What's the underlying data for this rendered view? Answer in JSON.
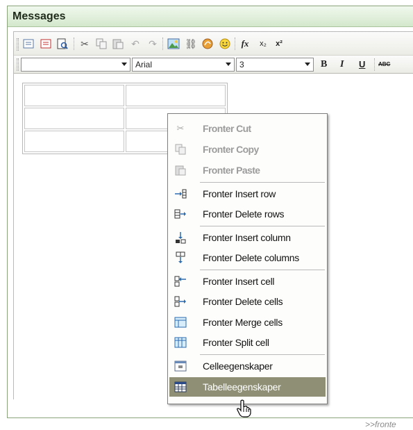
{
  "window": {
    "title": "Messages"
  },
  "toolbar1": {
    "icons": [
      "template-icon",
      "layout-icon",
      "preview-icon",
      "cut-icon",
      "copy-icon",
      "paste-icon",
      "undo-icon",
      "redo-icon",
      "image-icon",
      "link-icon",
      "flash-icon",
      "smiley-icon",
      "function-icon",
      "subscript-icon",
      "superscript-icon"
    ],
    "function_label": "fx",
    "subscript_label": "x₂",
    "superscript_label": "x²"
  },
  "toolbar2": {
    "style_value": "",
    "font_value": "Arial",
    "size_value": "3",
    "bold_label": "B",
    "italic_label": "I",
    "underline_label": "U",
    "strike_label": "ABC"
  },
  "context_menu": {
    "items": [
      {
        "label": "Fronter Cut",
        "icon": "cut-icon",
        "disabled": true
      },
      {
        "label": "Fronter Copy",
        "icon": "copy-icon",
        "disabled": true
      },
      {
        "label": "Fronter Paste",
        "icon": "paste-icon",
        "disabled": true
      },
      {
        "label": "Fronter Insert row",
        "icon": "insert-row-icon",
        "disabled": false
      },
      {
        "label": "Fronter Delete rows",
        "icon": "delete-rows-icon",
        "disabled": false
      },
      {
        "label": "Fronter Insert column",
        "icon": "insert-column-icon",
        "disabled": false
      },
      {
        "label": "Fronter Delete columns",
        "icon": "delete-columns-icon",
        "disabled": false
      },
      {
        "label": "Fronter Insert cell",
        "icon": "insert-cell-icon",
        "disabled": false
      },
      {
        "label": "Fronter Delete cells",
        "icon": "delete-cells-icon",
        "disabled": false
      },
      {
        "label": "Fronter Merge cells",
        "icon": "merge-cells-icon",
        "disabled": false
      },
      {
        "label": "Fronter Split cell",
        "icon": "split-cell-icon",
        "disabled": false
      },
      {
        "label": "Celleegenskaper",
        "icon": "cell-properties-icon",
        "disabled": false
      },
      {
        "label": "Tabelleegenskaper",
        "icon": "table-properties-icon",
        "disabled": false,
        "highlighted": true
      }
    ]
  },
  "watermark": ">>fronte",
  "colors": {
    "title_bar": "#d3e8cc",
    "menu_highlight": "#8e8f74",
    "disabled_text": "#9c9c9c"
  }
}
